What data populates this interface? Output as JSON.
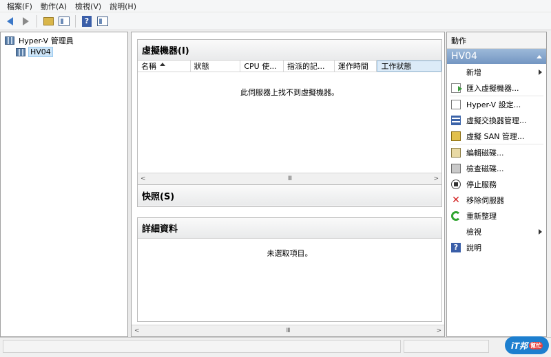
{
  "menu": {
    "items": [
      "檔案(F)",
      "動作(A)",
      "檢視(V)",
      "說明(H)"
    ]
  },
  "toolbar": {
    "buttons": [
      "back-arrow-icon",
      "forward-arrow-icon",
      "up-folder-icon",
      "show-hide-tree-icon",
      "help-icon",
      "action-pane-icon"
    ]
  },
  "tree": {
    "root_label": "Hyper-V 管理員",
    "child_label": "HV04"
  },
  "vm_section": {
    "title": "虛擬機器(I)",
    "columns": [
      "名稱",
      "狀態",
      "CPU 使...",
      "指派的記...",
      "運作時間",
      "工作狀態"
    ],
    "empty_message": "此伺服器上找不到虛擬機器。"
  },
  "snapshot_section": {
    "title": "快照(S)"
  },
  "details_section": {
    "title": "詳細資料",
    "empty_message": "未選取項目。"
  },
  "scroll": {
    "thumb": "III"
  },
  "actions": {
    "title": "動作",
    "group": "HV04",
    "items": [
      "新增",
      "匯入虛擬機器...",
      "Hyper-V 設定...",
      "虛擬交換器管理...",
      "虛擬 SAN 管理...",
      "編輯磁碟...",
      "檢查磁碟...",
      "停止服務",
      "移除伺服器",
      "重新整理",
      "檢視",
      "說明"
    ]
  },
  "brand": {
    "logo_text": "iT邦",
    "badge_text": "幫忙"
  },
  "colors": {
    "action_group_bg": "#7396c2",
    "selection_bg": "#cce4f7",
    "brand": "#1d7fcf"
  }
}
